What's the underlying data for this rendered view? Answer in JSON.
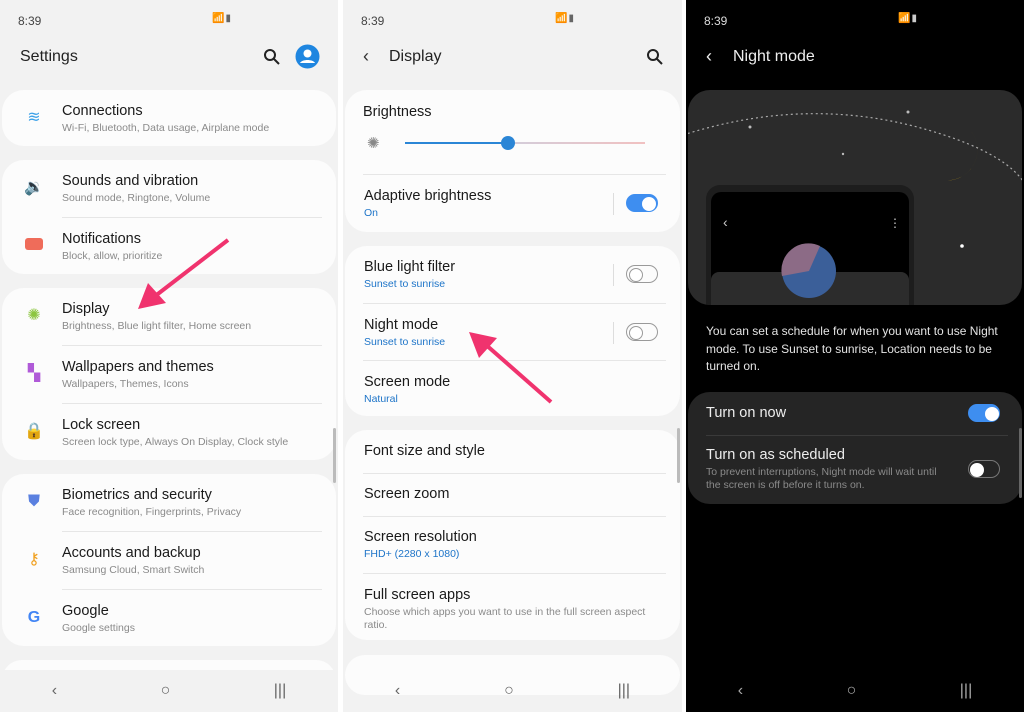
{
  "status": {
    "time": "8:39",
    "icons": "wifi signal battery"
  },
  "colors": {
    "accent": "#3e8ef0",
    "arrow": "#f0336e",
    "link": "#1d74c8"
  },
  "settings": {
    "title": "Settings",
    "groups": [
      [
        {
          "label": "Connections",
          "sub": "Wi-Fi, Bluetooth, Data usage, Airplane mode",
          "icon": "wifi-icon"
        }
      ],
      [
        {
          "label": "Sounds and vibration",
          "sub": "Sound mode, Ringtone, Volume",
          "icon": "volume-icon"
        },
        {
          "label": "Notifications",
          "sub": "Block, allow, prioritize",
          "icon": "notifications-icon"
        }
      ],
      [
        {
          "label": "Display",
          "sub": "Brightness, Blue light filter, Home screen",
          "icon": "sun-icon"
        },
        {
          "label": "Wallpapers and themes",
          "sub": "Wallpapers, Themes, Icons",
          "icon": "brush-icon"
        },
        {
          "label": "Lock screen",
          "sub": "Screen lock type, Always On Display, Clock style",
          "icon": "lock-icon"
        }
      ],
      [
        {
          "label": "Biometrics and security",
          "sub": "Face recognition, Fingerprints, Privacy",
          "icon": "shield-icon"
        },
        {
          "label": "Accounts and backup",
          "sub": "Samsung Cloud, Smart Switch",
          "icon": "key-icon"
        },
        {
          "label": "Google",
          "sub": "Google settings",
          "icon": "google-icon"
        }
      ]
    ]
  },
  "display": {
    "title": "Display",
    "brightness": {
      "label": "Brightness",
      "value_percent": 43
    },
    "adaptive": {
      "label": "Adaptive brightness",
      "sub": "On",
      "on": true
    },
    "blue_light": {
      "label": "Blue light filter",
      "sub": "Sunset to sunrise",
      "on": false
    },
    "night_mode": {
      "label": "Night mode",
      "sub": "Sunset to sunrise",
      "on": false
    },
    "screen_mode": {
      "label": "Screen mode",
      "sub": "Natural"
    },
    "font": {
      "label": "Font size and style"
    },
    "zoom": {
      "label": "Screen zoom"
    },
    "resolution": {
      "label": "Screen resolution",
      "sub": "FHD+ (2280 x 1080)"
    },
    "full_screen": {
      "label": "Full screen apps",
      "sub": "Choose which apps you want to use in the full screen aspect ratio."
    }
  },
  "night": {
    "title": "Night mode",
    "description": "You can set a schedule for when you want to use Night mode. To use Sunset to sunrise, Location needs to be turned on.",
    "turn_on_now": {
      "label": "Turn on now",
      "on": true
    },
    "scheduled": {
      "label": "Turn on as scheduled",
      "sub": "To prevent interruptions, Night mode will wait until the screen is off before it turns on.",
      "on": false
    }
  },
  "nav": {
    "back": "‹",
    "home": "○",
    "recents": "|||"
  }
}
